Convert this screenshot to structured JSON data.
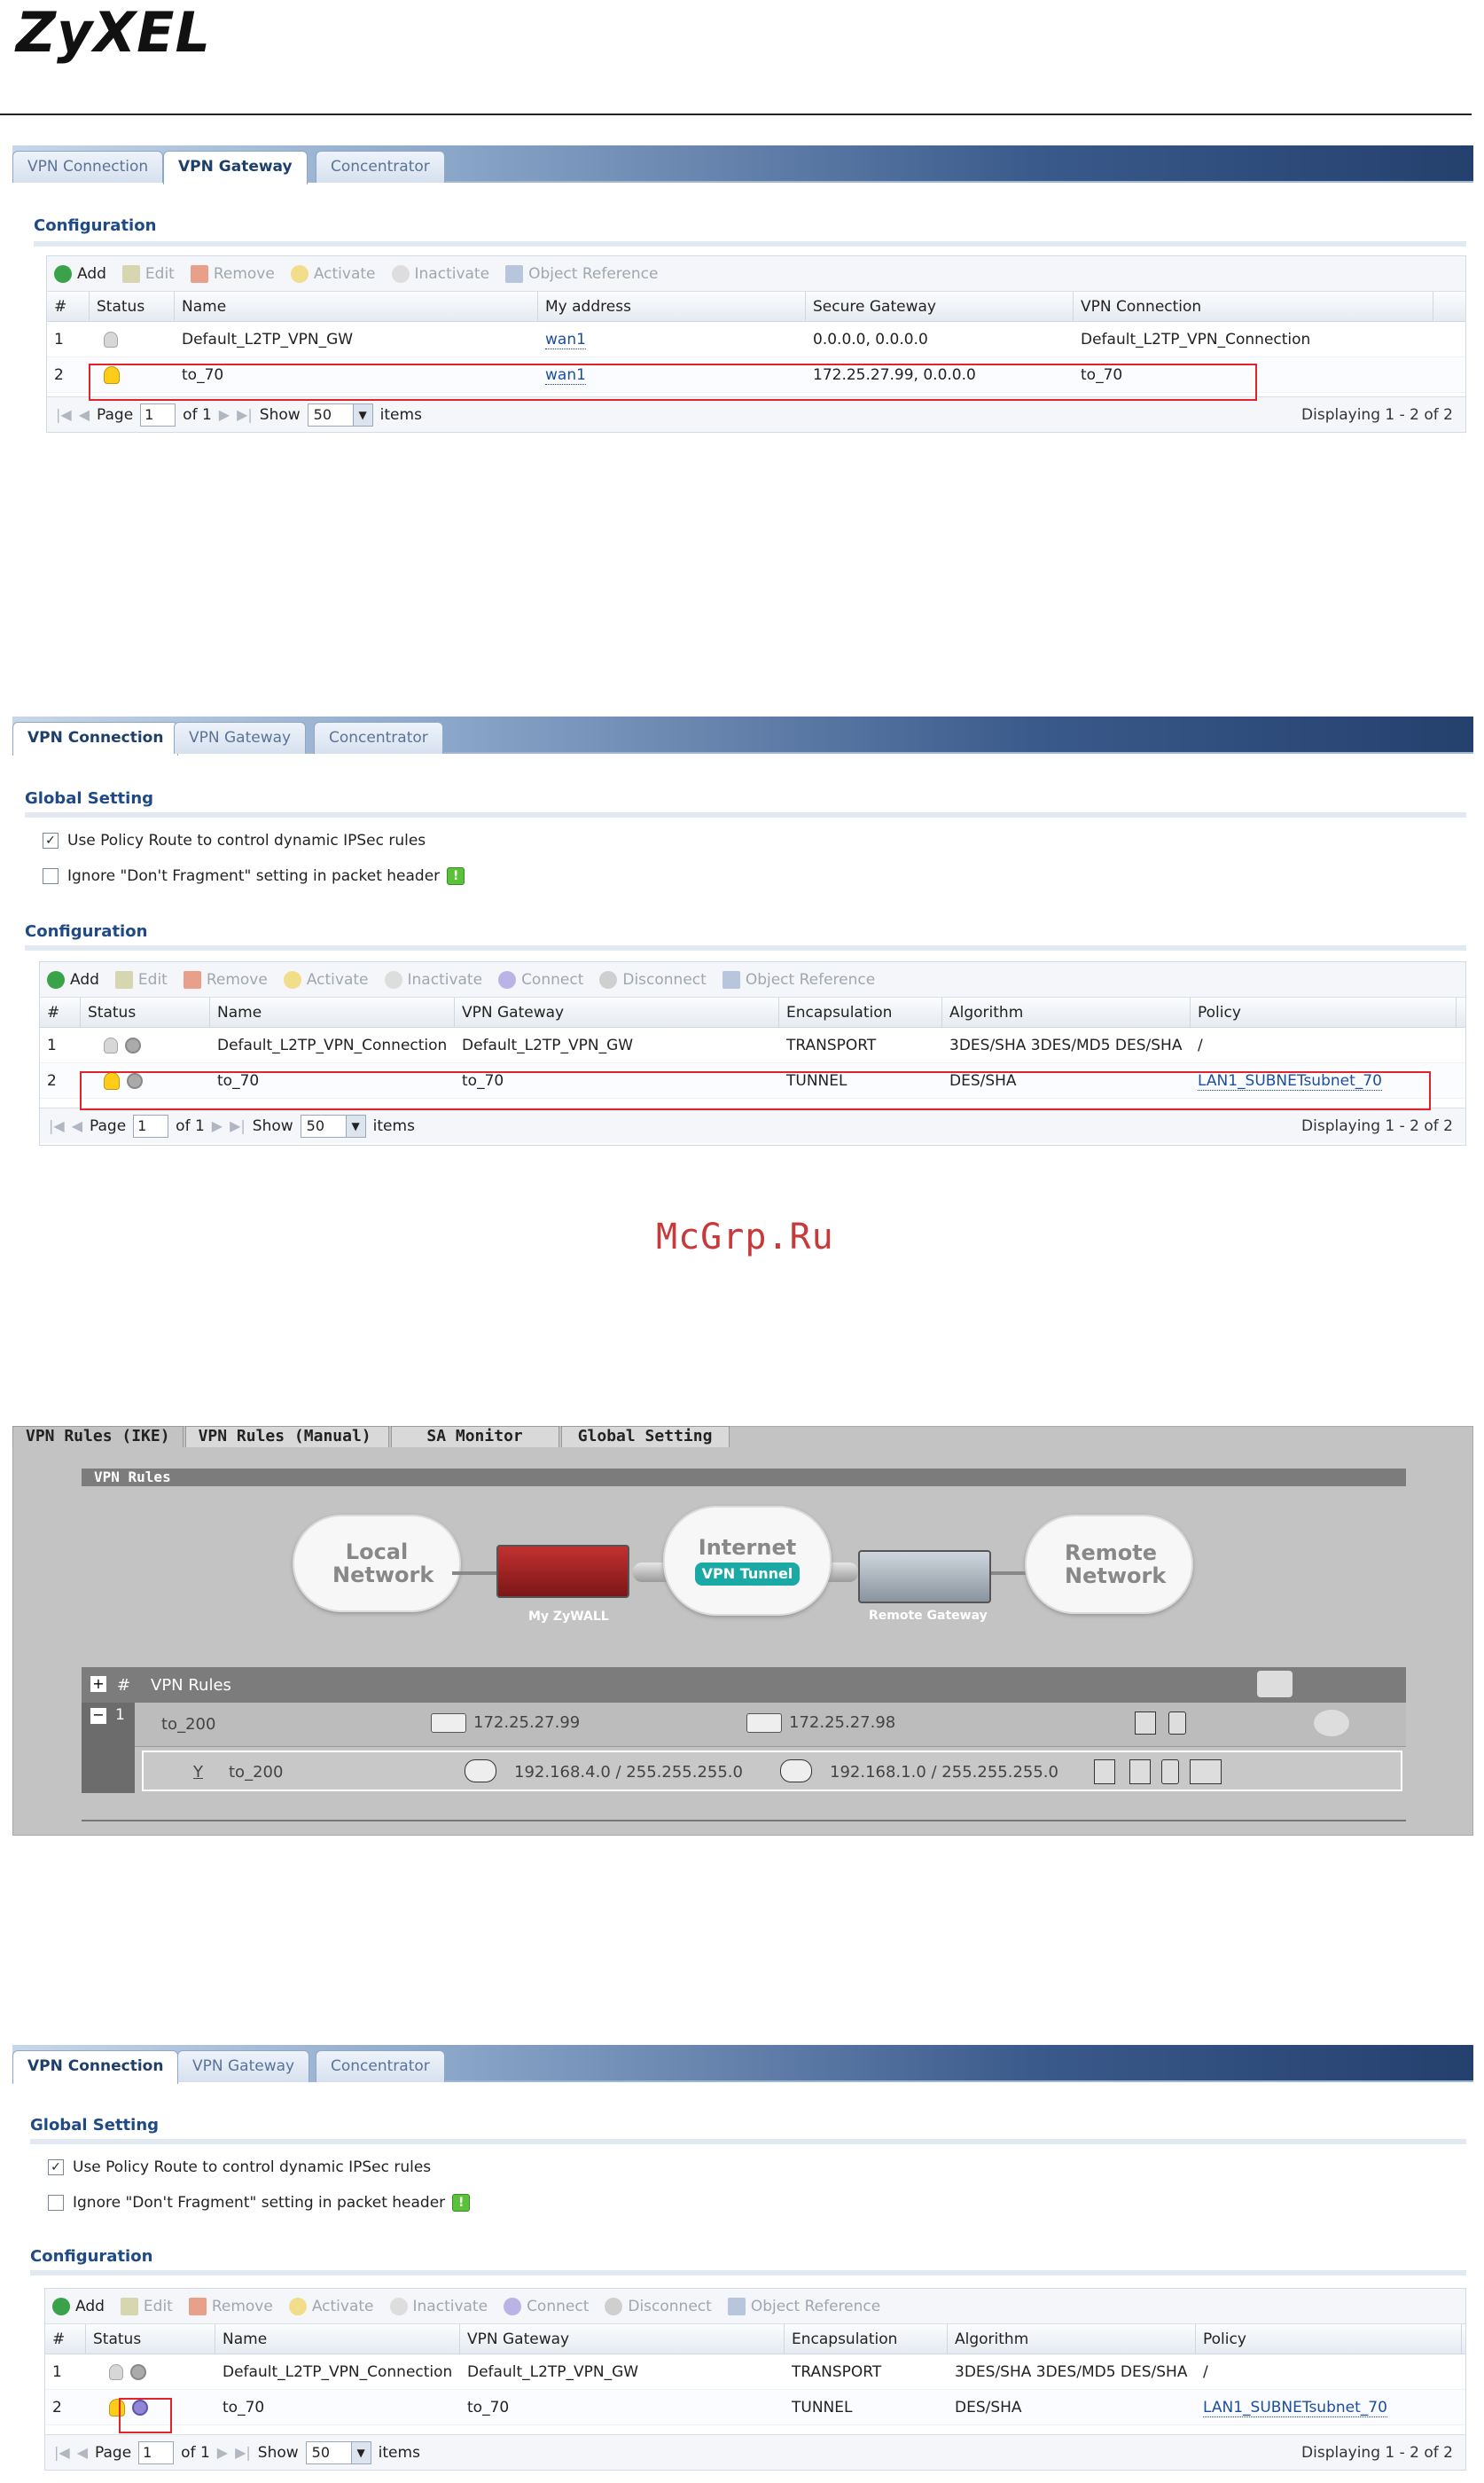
{
  "logo": "ZyXEL",
  "watermark": "McGrp.Ru",
  "panel1": {
    "tabs": [
      "VPN Connection",
      "VPN Gateway",
      "Concentrator"
    ],
    "active_tab": 1,
    "section": "Configuration",
    "toolbar": [
      "Add",
      "Edit",
      "Remove",
      "Activate",
      "Inactivate",
      "Object Reference"
    ],
    "columns": [
      "#",
      "Status",
      "Name",
      "My address",
      "Secure Gateway",
      "VPN Connection"
    ],
    "rows": [
      {
        "num": "1",
        "name": "Default_L2TP_VPN_GW",
        "my_address": "wan1",
        "secure_gateway": "0.0.0.0, 0.0.0.0",
        "vpn_connection": "Default_L2TP_VPN_Connection"
      },
      {
        "num": "2",
        "name": "to_70",
        "my_address": "wan1",
        "secure_gateway": "172.25.27.99, 0.0.0.0",
        "vpn_connection": "to_70"
      }
    ],
    "pager": {
      "page_label": "Page",
      "page": "1",
      "of": "of 1",
      "show": "Show",
      "per_page": "50",
      "items": "items",
      "display": "Displaying 1 - 2 of 2"
    }
  },
  "panel2": {
    "tabs": [
      "VPN Connection",
      "VPN Gateway",
      "Concentrator"
    ],
    "active_tab": 0,
    "global_section": "Global Setting",
    "opt1": "Use Policy Route to control dynamic IPSec rules",
    "opt2": "Ignore \"Don't Fragment\" setting in packet header",
    "section": "Configuration",
    "toolbar": [
      "Add",
      "Edit",
      "Remove",
      "Activate",
      "Inactivate",
      "Connect",
      "Disconnect",
      "Object Reference"
    ],
    "columns": [
      "#",
      "Status",
      "Name",
      "VPN Gateway",
      "Encapsulation",
      "Algorithm",
      "Policy"
    ],
    "rows": [
      {
        "num": "1",
        "name": "Default_L2TP_VPN_Connection",
        "gateway": "Default_L2TP_VPN_GW",
        "encap": "TRANSPORT",
        "algo": "3DES/SHA 3DES/MD5 DES/SHA",
        "policy_a": "/",
        "policy_b": ""
      },
      {
        "num": "2",
        "name": "to_70",
        "gateway": "to_70",
        "encap": "TUNNEL",
        "algo": "DES/SHA",
        "policy_a": "LAN1_SUBNET",
        "policy_b": "subnet_70"
      }
    ],
    "pager": {
      "page_label": "Page",
      "page": "1",
      "of": "of 1",
      "show": "Show",
      "per_page": "50",
      "items": "items",
      "display": "Displaying 1 - 2 of 2"
    }
  },
  "vpnrules": {
    "tabs": [
      "VPN Rules (IKE)",
      "VPN Rules (Manual)",
      "SA Monitor",
      "Global Setting"
    ],
    "title": "VPN Rules",
    "local": "Local Network",
    "internet": "Internet",
    "tunnel": "VPN Tunnel",
    "remote": "Remote Network",
    "my_zywall": "My ZyWALL",
    "remote_gw": "Remote Gateway",
    "header_hash": "#",
    "header_rules": "VPN Rules",
    "rule_num": "1",
    "rule_name": "to_200",
    "local_ip": "172.25.27.99",
    "remote_ip": "172.25.27.98",
    "sub_flag": "Y",
    "sub_name": "to_200",
    "sub_local": "192.168.4.0 / 255.255.255.0",
    "sub_remote": "192.168.1.0 / 255.255.255.0"
  }
}
